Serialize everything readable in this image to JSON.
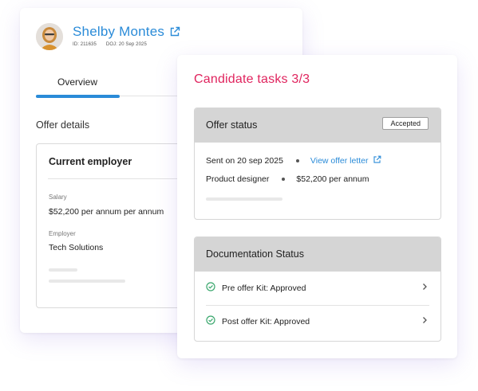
{
  "profile": {
    "name": "Shelby Montes",
    "id_text": "ID: 211635",
    "doj_text": "DOJ: 20 Sep 2025",
    "tab_overview": "Overview",
    "offer_details_title": "Offer details",
    "current_employer": {
      "title": "Current employer",
      "salary_label": "Salary",
      "salary_value": "$52,200 per annum per annum",
      "employer_label": "Employer",
      "employer_value": "Tech Solutions"
    }
  },
  "tasks": {
    "title": "Candidate tasks 3/3",
    "offer_status": {
      "label": "Offer status",
      "badge": "Accepted",
      "sent_text": "Sent on 20 sep 2025",
      "view_link": "View offer letter",
      "role": "Product designer",
      "salary": "$52,200 per annum"
    },
    "documentation": {
      "label": "Documentation Status",
      "items": [
        {
          "label": "Pre offer Kit: Approved"
        },
        {
          "label": "Post offer Kit: Approved"
        }
      ]
    }
  },
  "colors": {
    "accent_blue": "#2a8bd8",
    "title_pink": "#e0245e",
    "check_green": "#3aa76d",
    "header_gray": "#d5d5d5"
  },
  "icons": {
    "external_link": "external-link-icon",
    "check": "check-circle-icon",
    "chevron": "chevron-right-icon"
  }
}
